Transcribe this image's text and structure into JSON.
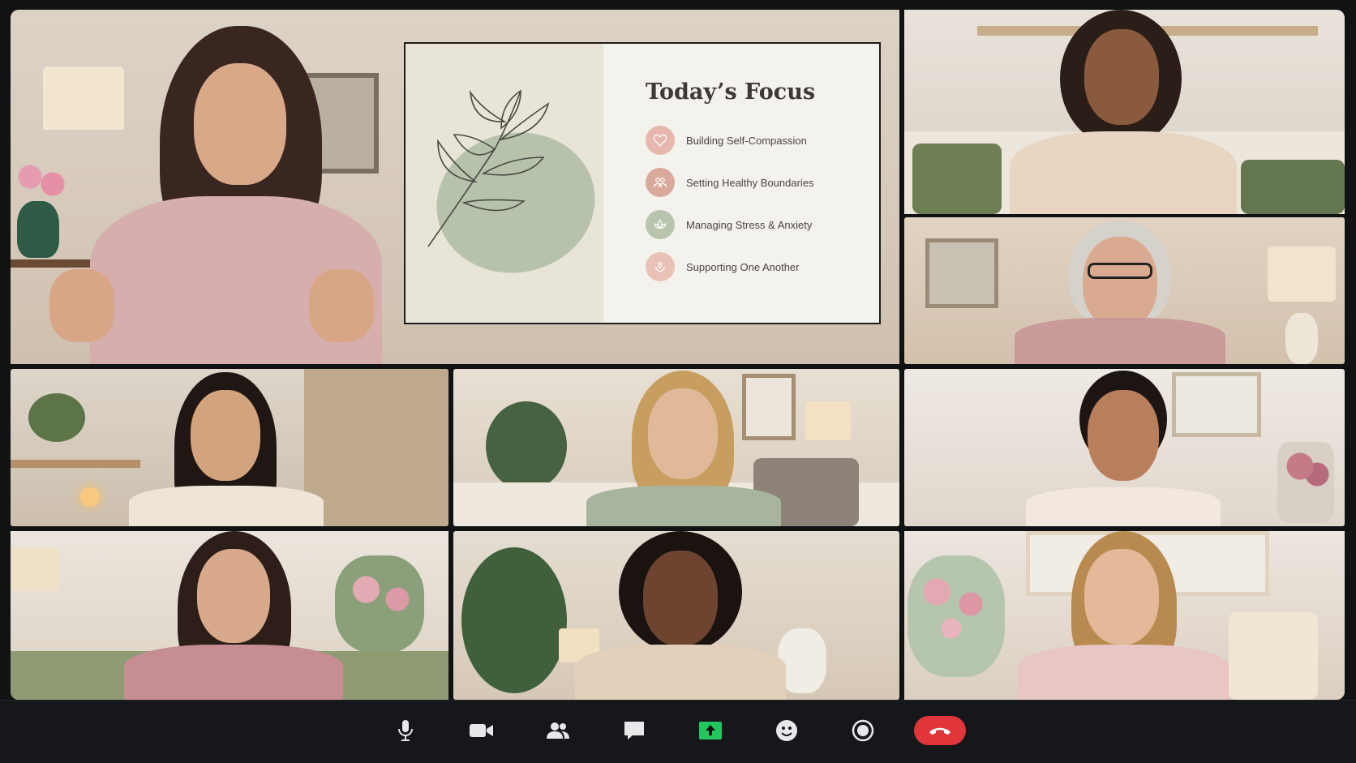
{
  "slide": {
    "title": "Today’s Focus",
    "items": [
      {
        "label": "Building Self-Compassion",
        "icon": "heart-icon",
        "color": "#e6b8ad"
      },
      {
        "label": "Setting Healthy Boundaries",
        "icon": "people-icon",
        "color": "#d9a99c"
      },
      {
        "label": "Managing Stress & Anxiety",
        "icon": "lotus-icon",
        "color": "#b8c4ae"
      },
      {
        "label": "Supporting One Another",
        "icon": "hands-icon",
        "color": "#e9c1b6"
      }
    ]
  },
  "participants": [
    {
      "role": "presenter",
      "sweater": "#d7aeae"
    },
    {
      "role": "participant",
      "sweater": "#e8d6c2"
    },
    {
      "role": "participant",
      "sweater": "#c89a9a"
    },
    {
      "role": "participant",
      "sweater": "#efe5d6"
    },
    {
      "role": "participant",
      "sweater": "#a8b59e"
    },
    {
      "role": "participant",
      "sweater": "#f2e8de"
    },
    {
      "role": "participant",
      "sweater": "#c68e93"
    },
    {
      "role": "participant",
      "sweater": "#e3d0bb"
    },
    {
      "role": "participant",
      "sweater": "#e8c6c6"
    }
  ],
  "controls": [
    {
      "name": "microphone-icon",
      "label": "Mute"
    },
    {
      "name": "camera-icon",
      "label": "Video"
    },
    {
      "name": "participants-icon",
      "label": "Participants"
    },
    {
      "name": "chat-icon",
      "label": "Chat"
    },
    {
      "name": "share-screen-icon",
      "label": "Share",
      "color": "#22c55e"
    },
    {
      "name": "reactions-icon",
      "label": "Reactions"
    },
    {
      "name": "record-icon",
      "label": "Record"
    },
    {
      "name": "end-call-icon",
      "label": "Leave",
      "color": "#e0353a"
    }
  ]
}
